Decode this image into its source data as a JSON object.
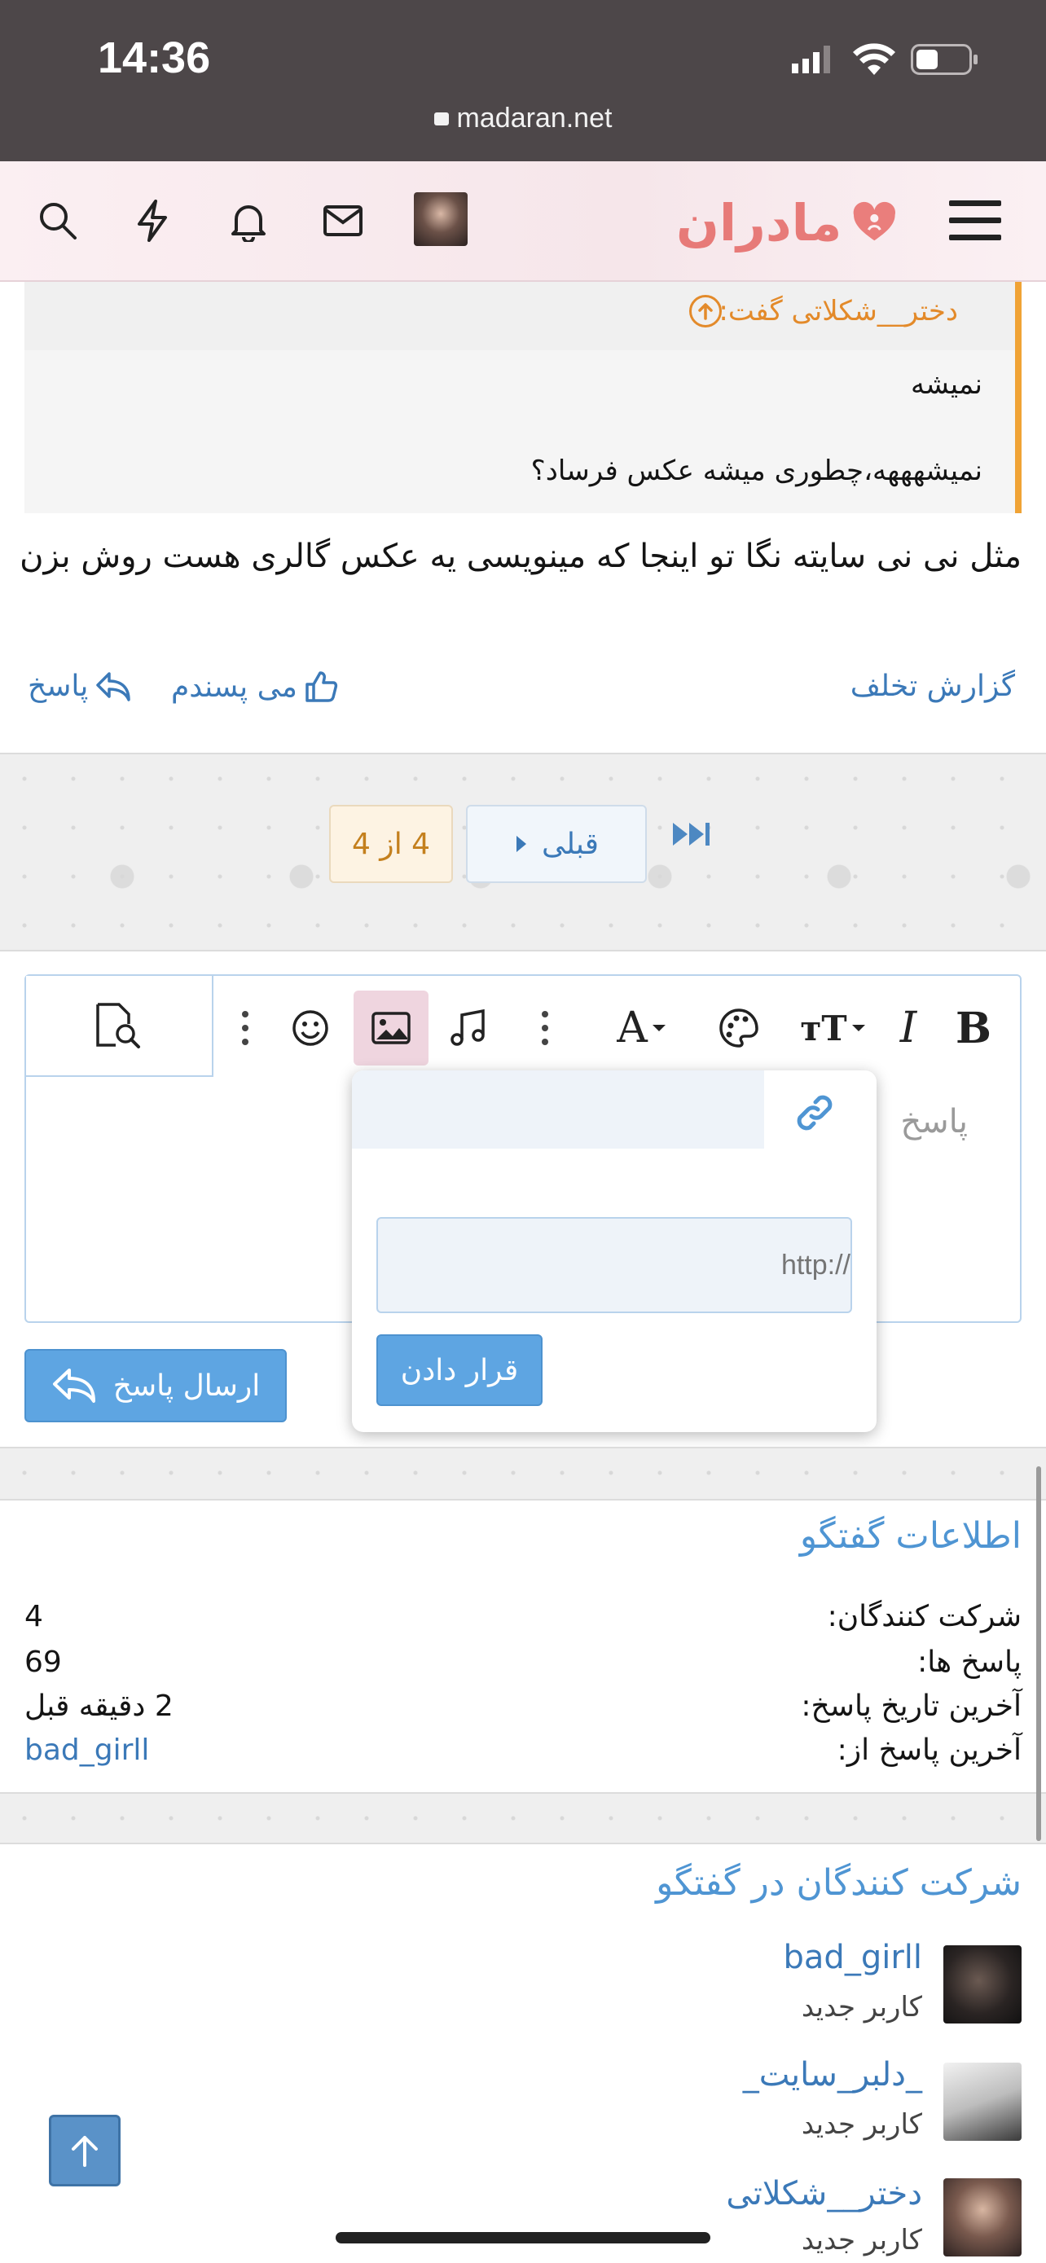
{
  "status_bar": {
    "time": "14:36",
    "url": "madaran.net"
  },
  "header": {
    "logo_text": "مادران"
  },
  "quote": {
    "author": "دختر__شکلاتی گفت:",
    "line1": "نمیشه",
    "line2": "نمیشهههه،چطوری میشه عکس فرساد؟"
  },
  "post": {
    "body": "مثل نی نی سایته نگا تو اینجا که مینویسی یه عکس گالری هست روش بزن",
    "actions": {
      "reply": "پاسخ",
      "like": "می پسندم",
      "report": "گزارش تخلف"
    }
  },
  "pagination": {
    "prev": "قبلی",
    "count": "4 از 4"
  },
  "editor": {
    "placeholder": "پاسخ",
    "send_label": "ارسال پاسخ",
    "toolbar": {
      "bold": "B",
      "italic": "I",
      "font_size": "тT",
      "text_color": "A"
    }
  },
  "image_popup": {
    "url_placeholder": "http://",
    "insert_label": "قرار دادن"
  },
  "thread_info": {
    "title": "اطلاعات گفتگو",
    "rows": [
      {
        "label": "شرکت کنندگان:",
        "value": "4"
      },
      {
        "label": "پاسخ ها:",
        "value": "69"
      },
      {
        "label": "آخرین تاریخ پاسخ:",
        "value": "2 دقیقه قبل"
      },
      {
        "label": "آخرین پاسخ از:",
        "value": "bad_girll"
      }
    ]
  },
  "participants": {
    "title": "شرکت کنندگان در گفتگو",
    "members": [
      {
        "name": "bad_girll",
        "role": "کاربر جدید"
      },
      {
        "name": "_دلبر_سایت_",
        "role": "کاربر جدید"
      },
      {
        "name": "دختر__شکلاتی",
        "role": "کاربر جدید"
      }
    ]
  },
  "colors": {
    "accent": "#4f95d3",
    "button": "#5ea5e2",
    "quote_border": "#f0a335",
    "logo": "#e77a78"
  }
}
